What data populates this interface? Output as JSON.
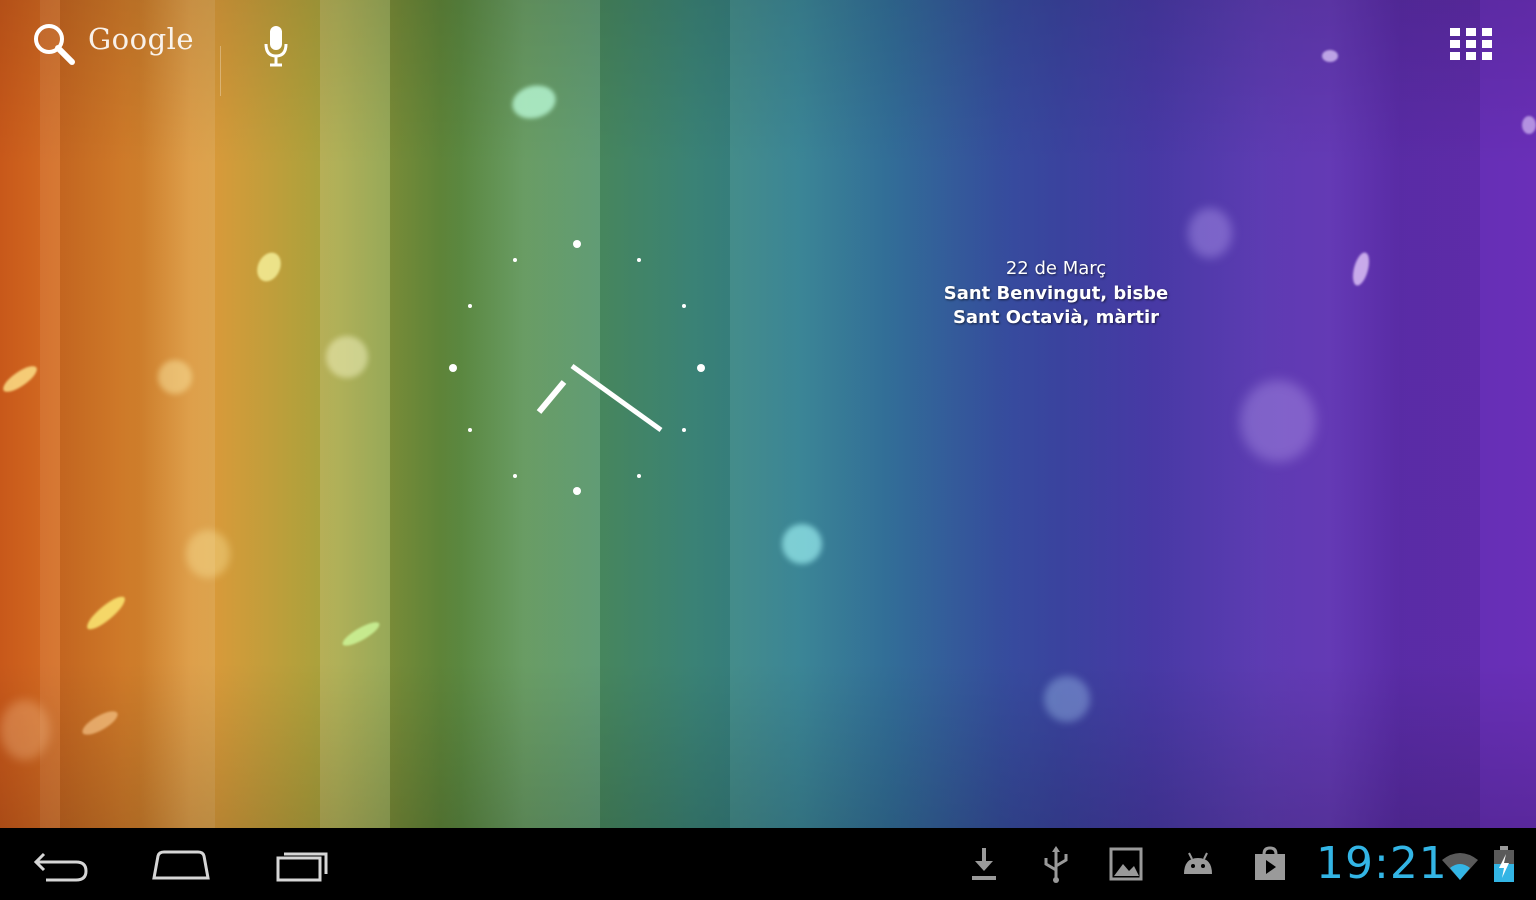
{
  "search": {
    "label": "Google"
  },
  "widget": {
    "date": "22 de Març",
    "saints": [
      "Sant Benvingut, bisbe",
      "Sant Octavià, màrtir"
    ]
  },
  "status_bar": {
    "time": "19:21"
  },
  "colors": {
    "accent_time": "#33b5e5",
    "nav_background": "#000000"
  },
  "icons": {
    "search": "search-icon",
    "mic": "microphone-icon",
    "apps": "app-drawer-icon",
    "back": "back-icon",
    "home": "home-icon",
    "recents": "recent-apps-icon",
    "download": "download-icon",
    "usb": "usb-icon",
    "gallery": "gallery-icon",
    "android": "android-icon",
    "store": "play-store-icon",
    "wifi": "wifi-icon",
    "battery": "battery-charging-icon"
  }
}
